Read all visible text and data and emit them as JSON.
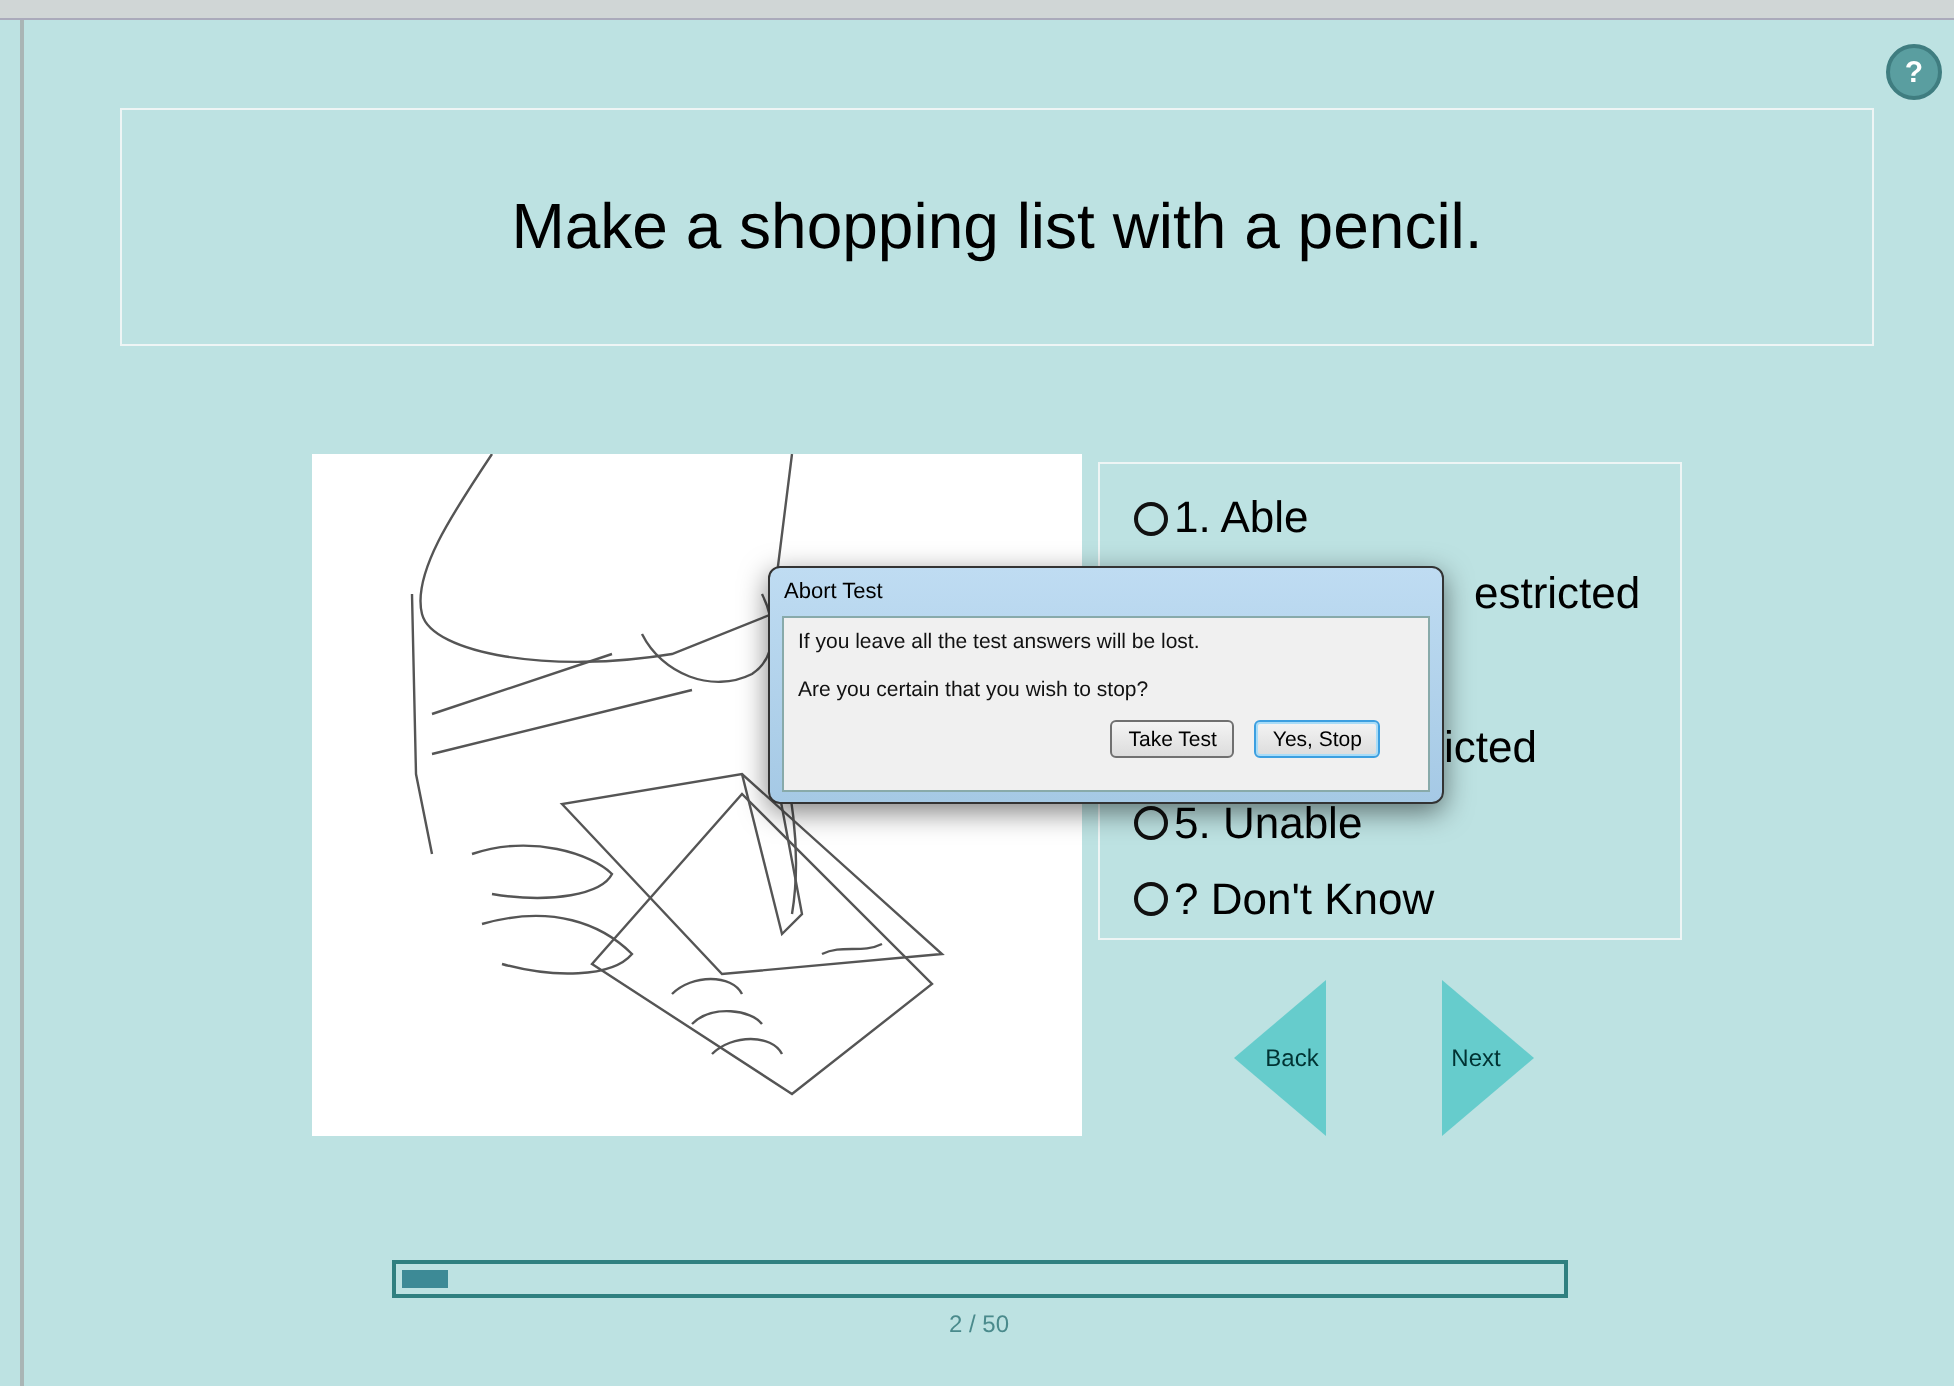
{
  "help": {
    "label": "?"
  },
  "question": "Make a shopping list with a pencil.",
  "options": [
    {
      "kind": "full",
      "label": "1. Able",
      "selected": false
    },
    {
      "kind": "covered",
      "label": "estricted"
    },
    {
      "kind": "hidden"
    },
    {
      "kind": "covered",
      "label": "icted"
    },
    {
      "kind": "full",
      "label": "5. Unable",
      "selected": false
    },
    {
      "kind": "full",
      "label": "?  Don't Know",
      "selected": false
    }
  ],
  "nav": {
    "back": "Back",
    "next": "Next"
  },
  "progress": {
    "level": 0.04,
    "label": "2 / 50"
  },
  "dialog": {
    "title": "Abort Test",
    "lines": [
      "If you leave all the test answers will be lost.",
      "Are you certain that you wish to stop?"
    ],
    "buttons": [
      {
        "label": "Take Test",
        "focused": false
      },
      {
        "label": "Yes, Stop",
        "focused": true
      }
    ]
  }
}
